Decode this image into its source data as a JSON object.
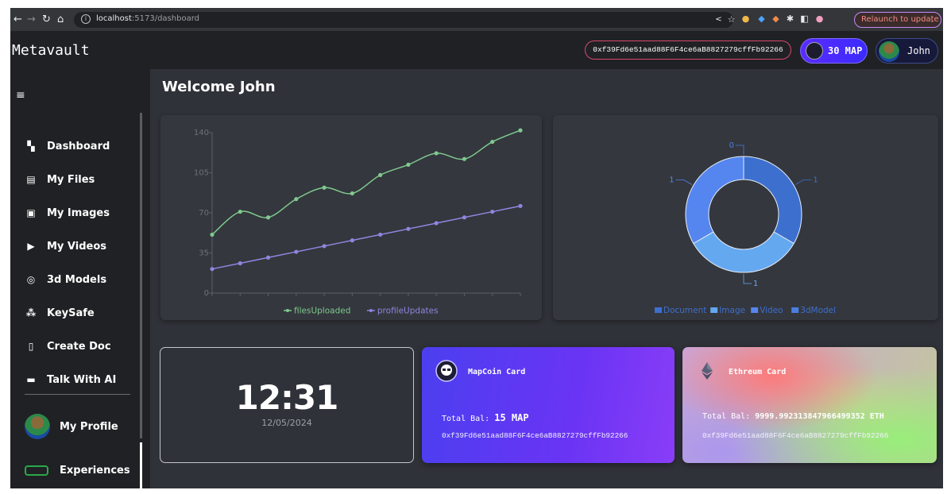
{
  "browser": {
    "url_host": "localhost",
    "url_path": ":5173/dashboard",
    "relaunch_label": "Relaunch to update",
    "relaunch_menu": "⋮"
  },
  "header": {
    "logo": "Metavault",
    "wallet_address": "0xf39Fd6e51aad88F6F4ce6aB8827279cffFb92266",
    "coin_label": "30 MAP",
    "user_name": "John"
  },
  "sidebar": {
    "items": [
      {
        "label": "Dashboard",
        "icon": "dashboard-icon",
        "glyph": "▚"
      },
      {
        "label": "My Files",
        "icon": "file-icon",
        "glyph": "▤"
      },
      {
        "label": "My Images",
        "icon": "image-icon",
        "glyph": "▣"
      },
      {
        "label": "My Videos",
        "icon": "video-icon",
        "glyph": "▶"
      },
      {
        "label": "3d Models",
        "icon": "cube-icon",
        "glyph": "◎"
      },
      {
        "label": "KeySafe",
        "icon": "password-icon",
        "glyph": "⁂"
      },
      {
        "label": "Create Doc",
        "icon": "new-doc-icon",
        "glyph": "▯"
      },
      {
        "label": "Talk With AI",
        "icon": "chat-icon",
        "glyph": "▬"
      }
    ],
    "profile_label": "My Profile",
    "experiences_label": "Experiences"
  },
  "main": {
    "welcome": "Welcome John"
  },
  "chart_data": [
    {
      "type": "line",
      "x": [
        1,
        2,
        3,
        4,
        5,
        6,
        7,
        8,
        9,
        10,
        11,
        12
      ],
      "ylim": [
        0,
        140
      ],
      "yticks": [
        0,
        35,
        70,
        105,
        140
      ],
      "grid": false,
      "legend_position": "bottom",
      "series": [
        {
          "name": "filesUploaded",
          "color": "#7fc98f",
          "values": [
            51,
            71,
            66,
            82,
            92,
            87,
            103,
            112,
            122,
            117,
            132,
            142
          ]
        },
        {
          "name": "profileUpdates",
          "color": "#8f85e0",
          "values": [
            21,
            26,
            31,
            36,
            41,
            46,
            51,
            56,
            61,
            66,
            71,
            76
          ]
        }
      ]
    },
    {
      "type": "pie",
      "donut": true,
      "legend_position": "bottom",
      "categories": [
        "Document",
        "Image",
        "Video",
        "3dModel"
      ],
      "values": [
        1,
        1,
        1,
        0
      ],
      "colors": [
        "#3d6fcf",
        "#64a8f0",
        "#5585ef",
        "#4a7fe0"
      ]
    }
  ],
  "clock": {
    "time": "12:31",
    "date": "12/05/2024"
  },
  "mapcoin_card": {
    "title": "MapCoin Card",
    "bal_prefix": "Total Bal:",
    "bal_value": "15 MAP",
    "address": "0xf39Fd6e51aad88F6F4ce6aB8827279cffFb92266"
  },
  "eth_card": {
    "title": "Ethreum Card",
    "bal_prefix": "Total Bal:",
    "bal_value": "9999.992313847966499352 ETH",
    "address": "0xf39Fd6e51aad88F6F4ce6aB8827279cffFb92266"
  }
}
